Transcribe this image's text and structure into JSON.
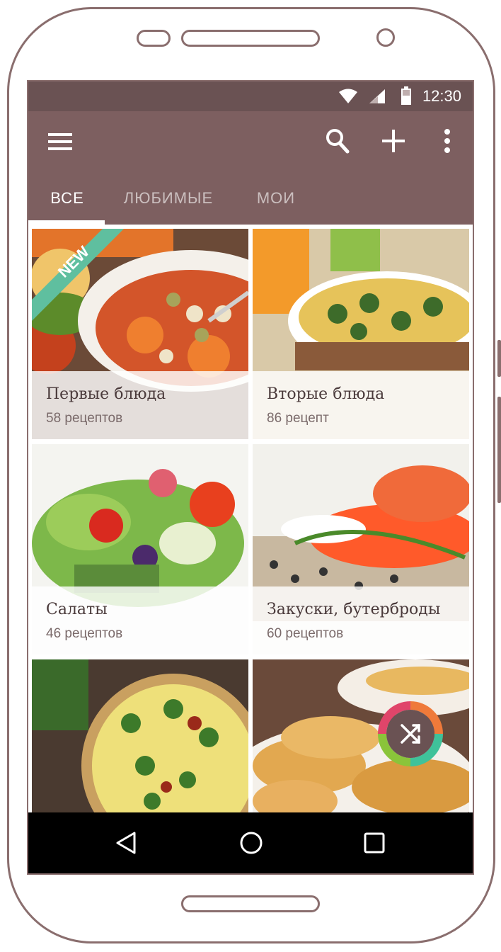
{
  "status_bar": {
    "time": "12:30"
  },
  "app_bar": {
    "icons": [
      "menu-icon",
      "search-icon",
      "add-icon",
      "more-vert-icon"
    ]
  },
  "tabs": [
    {
      "label": "ВСЕ",
      "active": true
    },
    {
      "label": "ЛЮБИМЫЕ",
      "active": false
    },
    {
      "label": "МОИ",
      "active": false
    }
  ],
  "badge": {
    "label": "NEW"
  },
  "categories": [
    {
      "title": "Первые блюда",
      "count": "58 рецептов"
    },
    {
      "title": "Вторые блюда",
      "count": "86 рецепт"
    },
    {
      "title": "Салаты",
      "count": "46 рецептов"
    },
    {
      "title": "Закуски, бутерброды",
      "count": "60 рецептов"
    },
    {
      "title": "",
      "count": ""
    },
    {
      "title": "",
      "count": ""
    }
  ],
  "fab": {
    "icon": "shuffle-icon"
  },
  "nav": {
    "icons": [
      "back-icon",
      "home-icon",
      "recents-icon"
    ]
  },
  "colors": {
    "primary": "#7d5f60",
    "primary_dark": "#6a5253",
    "badge": "#5fbf9f"
  }
}
